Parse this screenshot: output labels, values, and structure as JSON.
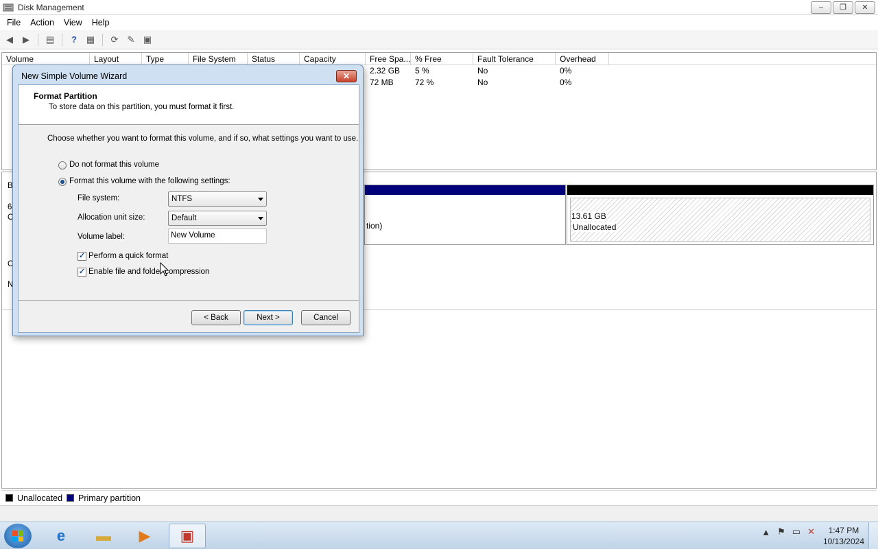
{
  "window": {
    "title": "Disk Management",
    "minimize": "–",
    "restore": "❐",
    "close": "✕"
  },
  "menu": [
    "File",
    "Action",
    "View",
    "Help"
  ],
  "toolbar": {
    "icons": [
      "back-icon",
      "forward-icon",
      "console-tree-icon",
      "help-icon",
      "properties-icon",
      "refresh-icon",
      "rescan-icon",
      "export-icon"
    ]
  },
  "volume_list": {
    "columns": [
      "Volume",
      "Layout",
      "Type",
      "File System",
      "Status",
      "Capacity",
      "Free Spa...",
      "% Free",
      "Fault Tolerance",
      "Overhead"
    ],
    "rows": [
      {
        "free": "2.32 GB",
        "pct_free": "5 %",
        "fault": "No",
        "overhead": "0%"
      },
      {
        "free": "72 MB",
        "pct_free": "72 %",
        "fault": "No",
        "overhead": "0%"
      }
    ]
  },
  "disk": {
    "primary_partial_text": "tion)",
    "unallocated_size": "13.61 GB",
    "unallocated_label": "Unallocated",
    "left_labels": [
      "B",
      "6",
      "O"
    ],
    "left_labels2": [
      "C",
      "N"
    ]
  },
  "legend": {
    "unallocated": "Unallocated",
    "primary": "Primary partition",
    "unallocated_color": "#000000",
    "primary_color": "#00007a"
  },
  "dialog": {
    "title": "New Simple Volume Wizard",
    "close": "✕",
    "header_title": "Format Partition",
    "header_subtitle": "To store data on this partition, you must format it first.",
    "intro": "Choose whether you want to format this volume, and if so, what settings you want to use.",
    "opt_no_format": "Do not format this volume",
    "opt_format": "Format this volume with the following settings:",
    "fs_label": "File system:",
    "fs_value": "NTFS",
    "alloc_label": "Allocation unit size:",
    "alloc_value": "Default",
    "vol_label": "Volume label:",
    "vol_value": "New Volume",
    "quick_format": "Perform a quick format",
    "compression": "Enable file and folder compression",
    "back": "< Back",
    "next": "Next >",
    "cancel": "Cancel"
  },
  "taskbar": {
    "apps": [
      "internet-explorer-icon",
      "explorer-folder-icon",
      "media-player-icon",
      "disk-management-icon"
    ],
    "time": "1:47 PM",
    "date": "10/13/2024"
  }
}
